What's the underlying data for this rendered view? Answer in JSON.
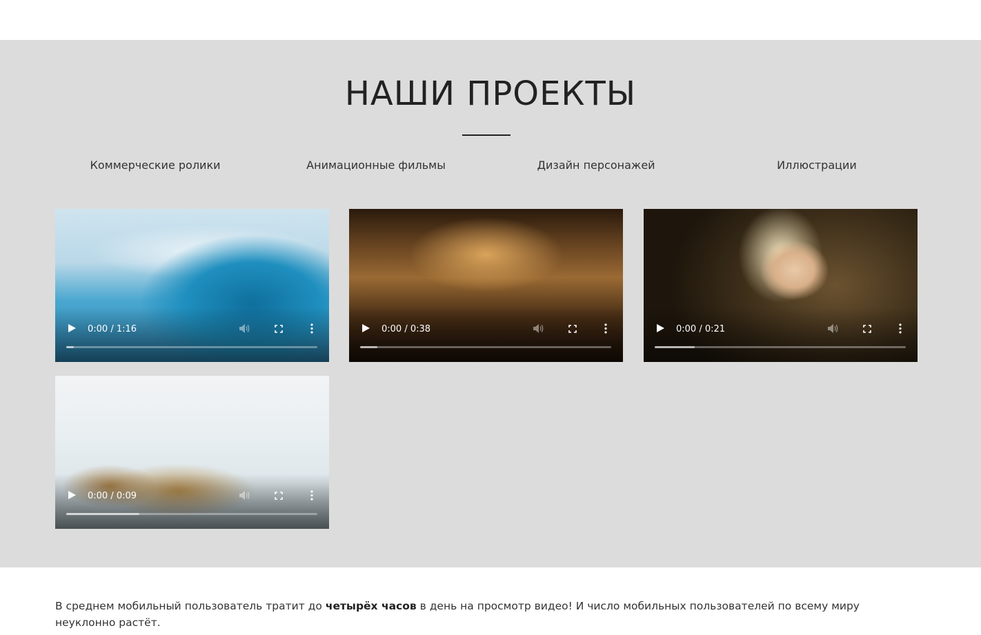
{
  "section": {
    "title": "НАШИ ПРОЕКТЫ",
    "tabs": [
      {
        "label": "Коммерческие ролики"
      },
      {
        "label": "Анимационные фильмы"
      },
      {
        "label": "Дизайн персонажей"
      },
      {
        "label": "Иллюстрации"
      }
    ]
  },
  "videos": [
    {
      "time": "0:00 / 1:16",
      "progress": 0.03,
      "scene": "ocean wave painting"
    },
    {
      "time": "0:00 / 0:38",
      "progress": 0.07,
      "scene": "old city canal painting"
    },
    {
      "time": "0:00 / 0:21",
      "progress": 0.16,
      "scene": "blonde woman with clock"
    },
    {
      "time": "0:00 / 0:09",
      "progress": 0.29,
      "scene": "winter landscape with trees"
    }
  ],
  "bottom": {
    "part1": "В среднем мобильный пользователь тратит до ",
    "bold": "четырёх часов",
    "part2": " в день на просмотр видео! И число мобильных пользователей по всему миру неуклонно растёт."
  },
  "icons": [
    "play-icon",
    "volume-icon",
    "fullscreen-icon",
    "more-vert-icon"
  ],
  "colors": {
    "section_bg": "#dcdcdc",
    "text": "#222222"
  }
}
